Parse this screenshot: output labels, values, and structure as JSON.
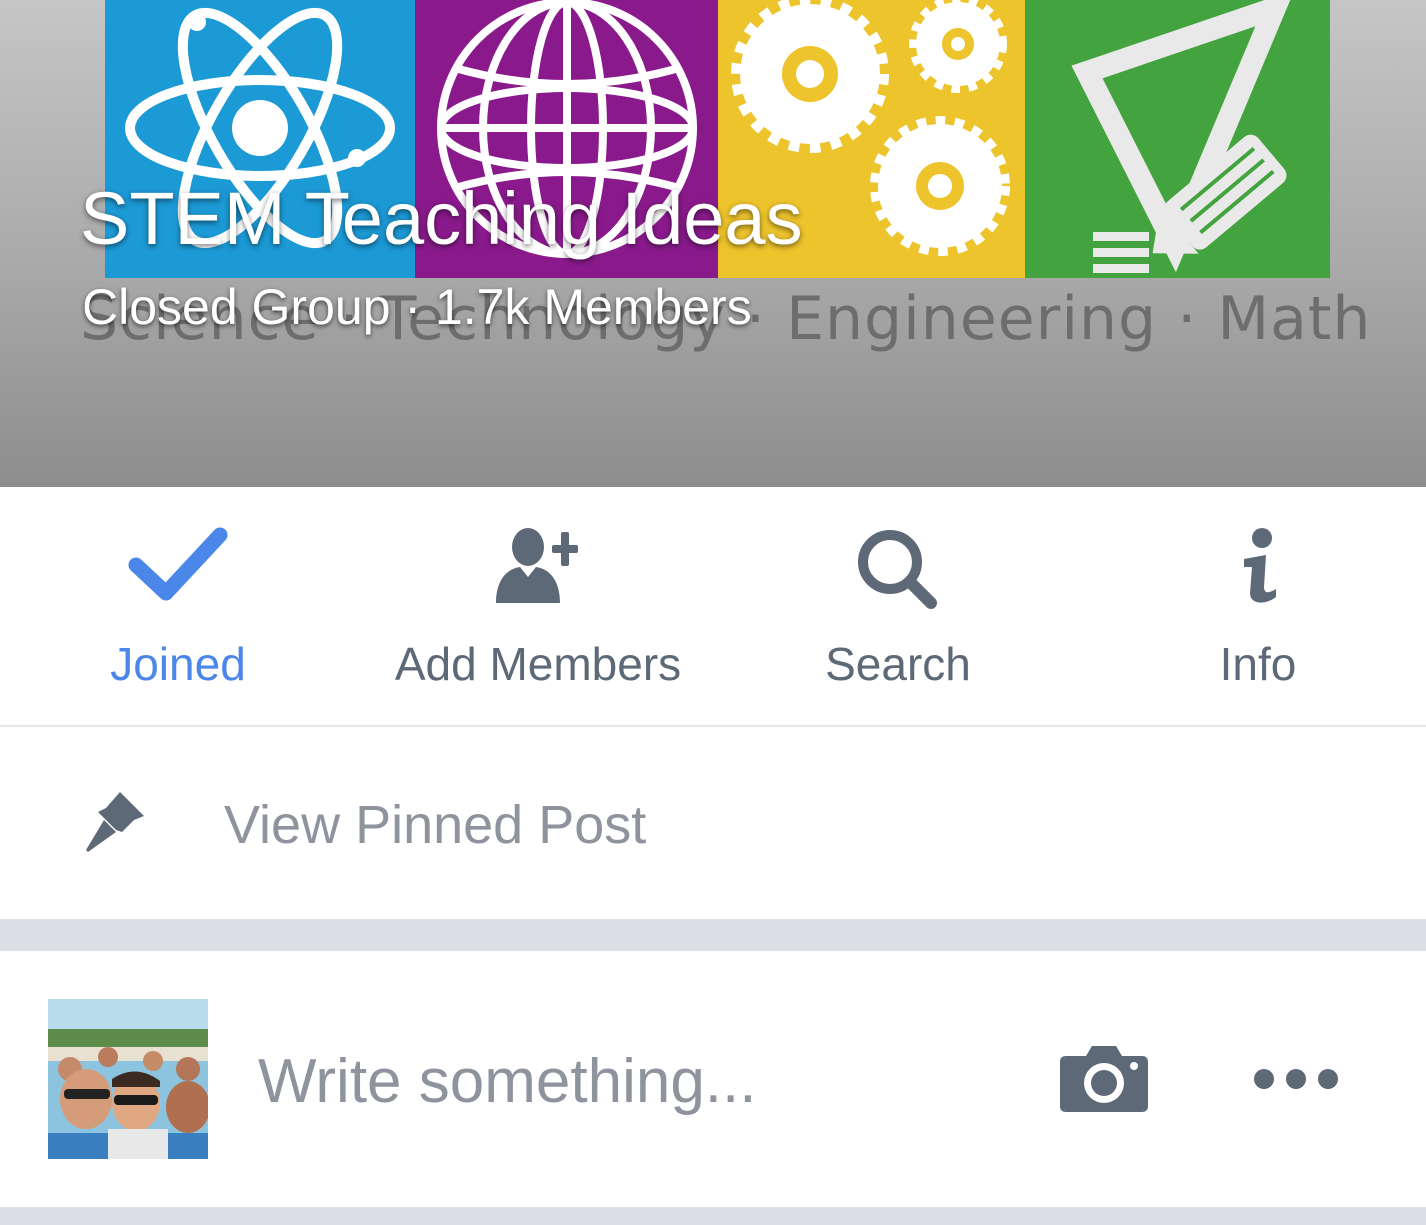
{
  "cover": {
    "stem_words": "Science · Technology · Engineering · Math",
    "title": "STEM Teaching Ideas",
    "subtitle": "Closed Group · 1.7k Members"
  },
  "actions": [
    {
      "label": "Joined",
      "icon": "checkmark-icon",
      "active": true
    },
    {
      "label": "Add Members",
      "icon": "add-person-icon",
      "active": false
    },
    {
      "label": "Search",
      "icon": "magnifier-icon",
      "active": false
    },
    {
      "label": "Info",
      "icon": "info-icon",
      "active": false
    }
  ],
  "pinned": {
    "label": "View Pinned Post",
    "icon": "pushpin-icon"
  },
  "composer": {
    "placeholder": "Write something...",
    "photo_icon": "camera-icon",
    "more_icon": "more-dots-icon"
  },
  "colors": {
    "accent": "#4a87e8",
    "icon_gray": "#5e6978",
    "muted_text": "#8e939d"
  }
}
